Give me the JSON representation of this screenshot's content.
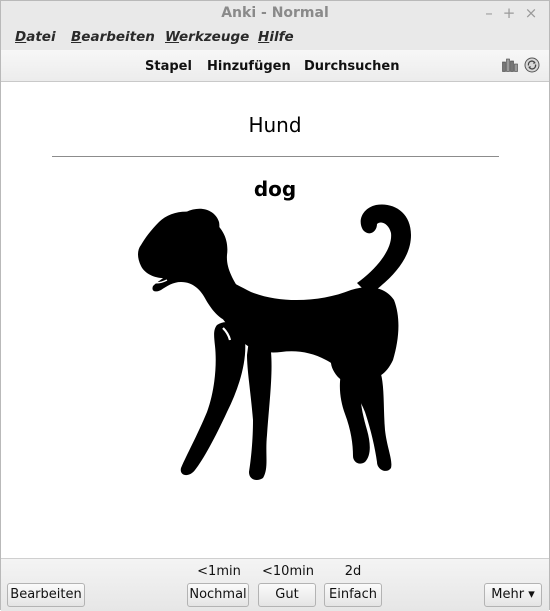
{
  "window": {
    "title": "Anki - Normal",
    "controls": {
      "minimize": "–",
      "maximize": "+",
      "close": "×"
    }
  },
  "menu": [
    {
      "mnemonic": "D",
      "rest": "atei"
    },
    {
      "mnemonic": "B",
      "rest": "earbeiten"
    },
    {
      "mnemonic": "W",
      "rest": "erkzeuge"
    },
    {
      "mnemonic": "H",
      "rest": "ilfe"
    }
  ],
  "toolbar": {
    "decks": "Stapel",
    "add": "Hinzufügen",
    "browse": "Durchsuchen",
    "icons": [
      "stats-icon",
      "sync-icon"
    ]
  },
  "card": {
    "front": "Hund",
    "back": "dog",
    "image": "dog-silhouette"
  },
  "answer_bar": {
    "edit": "Bearbeiten",
    "more": "Mehr ▾",
    "buttons": [
      {
        "label": "Nochmal",
        "interval": "<1min"
      },
      {
        "label": "Gut",
        "interval": "<10min"
      },
      {
        "label": "Einfach",
        "interval": "2d"
      }
    ]
  },
  "colors": {
    "titlebar_bg": "#e9e9e9",
    "title_text": "#8a8a8a",
    "card_bg": "#ffffff",
    "image_fill": "#000000"
  }
}
